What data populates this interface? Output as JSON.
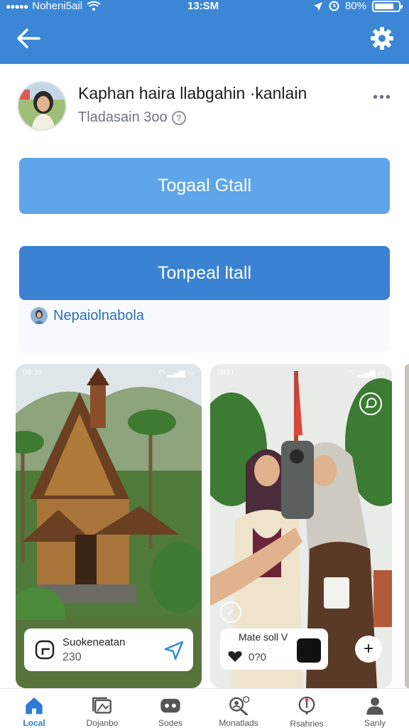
{
  "status": {
    "signal_dots": "●●●●●",
    "carrier": "Noheni5ail",
    "time": "13:SM",
    "battery": "80%",
    "battery_level": 0.8
  },
  "header": {
    "back_icon": "arrow-left-icon",
    "settings_icon": "gear-icon"
  },
  "profile": {
    "name": "Kaphan haira llabgahin ·kanlain",
    "subtitle": "Tladasain 3oo",
    "info_icon_glyph": "?",
    "more_glyph": "•••"
  },
  "actions": {
    "primary_label": "Togaal Gtall",
    "secondary_label": "Tonpeal ltall",
    "link_label": "Nepaiolnabola"
  },
  "cards": [
    {
      "status_left": "08:38",
      "caption_title": "Suokeneatan",
      "caption_count": "230"
    },
    {
      "status_left": "0931",
      "caption_title": "Mate soll V",
      "caption_count": "0?0"
    }
  ],
  "nav": {
    "items": [
      {
        "label": "Local",
        "icon": "home-icon",
        "active": true
      },
      {
        "label": "Dojanbo",
        "icon": "gallery-icon",
        "active": false
      },
      {
        "label": "Sodes",
        "icon": "gamepad-icon",
        "active": false
      },
      {
        "label": "Monatlads",
        "icon": "search-people-icon",
        "active": false
      },
      {
        "label": "Rsahries",
        "icon": "location-icon",
        "active": false
      },
      {
        "label": "Sanly",
        "icon": "person-icon",
        "active": false
      }
    ]
  },
  "colors": {
    "header": "#3c86d6",
    "primary_button": "#5fa5ea",
    "secondary_button": "#3b82d2",
    "link": "#2f6fb8",
    "active_nav": "#2f7bd3"
  }
}
